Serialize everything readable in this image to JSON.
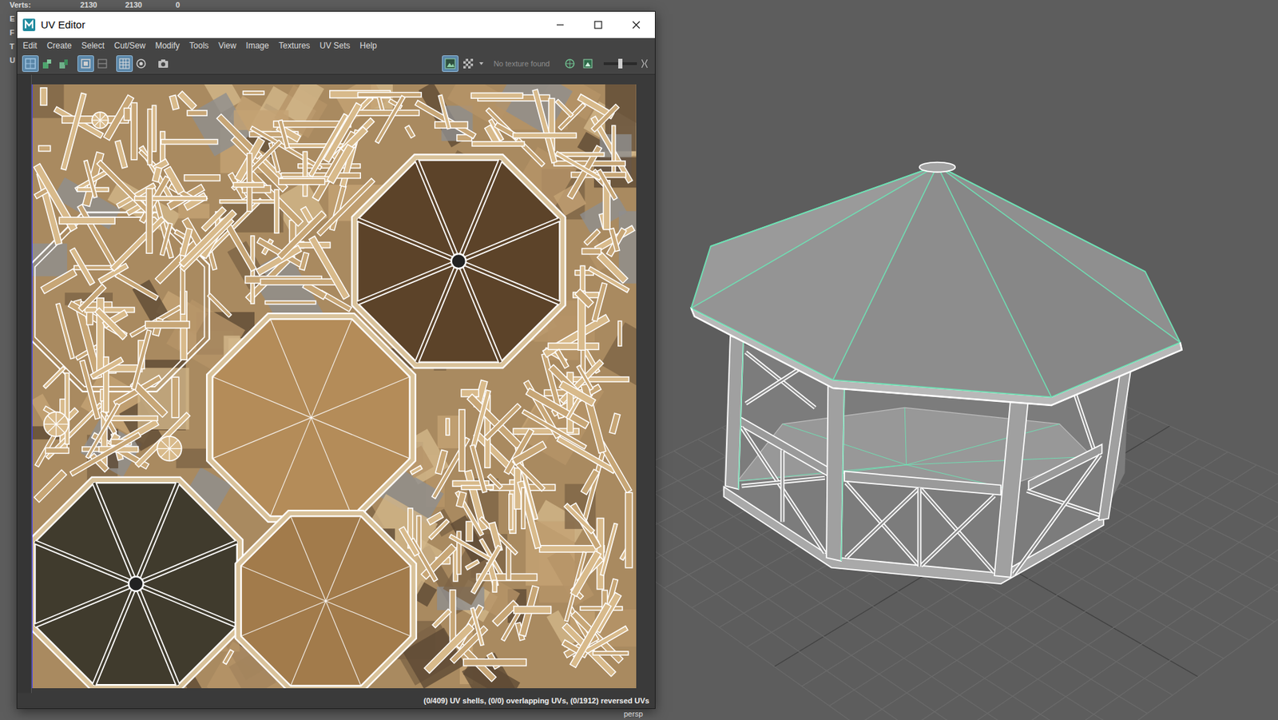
{
  "hud": {
    "rows": [
      {
        "label": "Verts:",
        "values": [
          "2130",
          "2130",
          "0"
        ]
      },
      {
        "label": "E",
        "values": []
      },
      {
        "label": "F",
        "values": []
      },
      {
        "label": "T",
        "values": []
      },
      {
        "label": "U",
        "values": []
      }
    ]
  },
  "window": {
    "title": "UV Editor"
  },
  "menu": [
    "Edit",
    "Create",
    "Select",
    "Cut/Sew",
    "Modify",
    "Tools",
    "View",
    "Image",
    "Textures",
    "UV Sets",
    "Help"
  ],
  "toolbar": {
    "left_buttons": [
      {
        "selected": true
      },
      {
        "selected": false
      },
      {
        "selected": false
      },
      {
        "selected": true
      },
      {
        "selected": false
      },
      {
        "selected": true
      },
      {
        "selected": false
      },
      {
        "selected": false
      }
    ],
    "right_buttons": [
      {
        "selected": true
      },
      {
        "selected": false
      }
    ],
    "texture_status": "No texture found",
    "after_buttons": [
      {
        "selected": false
      },
      {
        "selected": false
      }
    ],
    "slider": {
      "level": 0.5
    }
  },
  "status_bar": "(0/409) UV shells, (0/0) overlapping UVs, (0/1912) reversed UVs",
  "viewport": {
    "camera": "persp"
  }
}
